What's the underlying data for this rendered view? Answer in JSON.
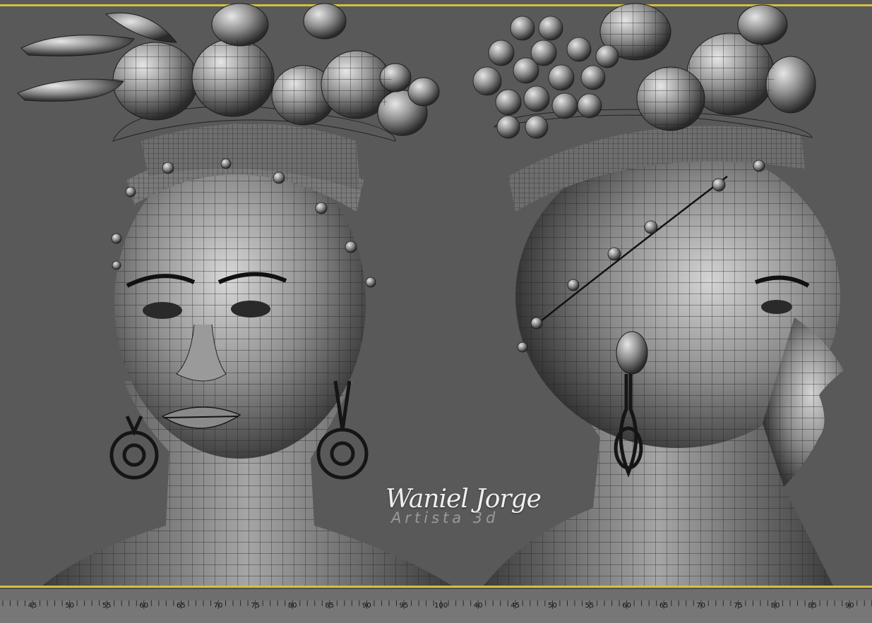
{
  "watermark": {
    "name": "Waniel Jorge",
    "subtitle": "Artista 3d"
  },
  "timeline": {
    "labels": [
      "45",
      "50",
      "55",
      "60",
      "65",
      "70",
      "75",
      "80",
      "85",
      "90",
      "95",
      "100",
      "40",
      "45",
      "50",
      "55",
      "60",
      "65",
      "70",
      "75",
      "80",
      "85",
      "90"
    ]
  },
  "colors": {
    "viewport_bg": "#595959",
    "frame_accent": "#d2bf43",
    "mesh_base": "#8c8c8c",
    "wire": "#1e1e1e"
  }
}
